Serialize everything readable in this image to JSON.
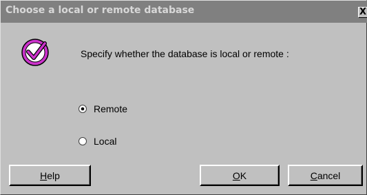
{
  "window": {
    "title": "Choose a local or remote database",
    "close_label": "X"
  },
  "prompt": "Specify whether the database is local or remote :",
  "options": [
    {
      "label": "Remote",
      "selected": true
    },
    {
      "label": "Local",
      "selected": false
    }
  ],
  "buttons": {
    "help": {
      "mnemonic": "H",
      "rest": "elp"
    },
    "ok": {
      "mnemonic": "O",
      "rest": "K"
    },
    "cancel": {
      "mnemonic": "C",
      "rest": "ancel"
    }
  },
  "colors": {
    "icon": "#cc33cc",
    "titlebar": "#808080",
    "background": "#c0c0c0"
  },
  "icons": {
    "check": "checkmark-icon"
  }
}
